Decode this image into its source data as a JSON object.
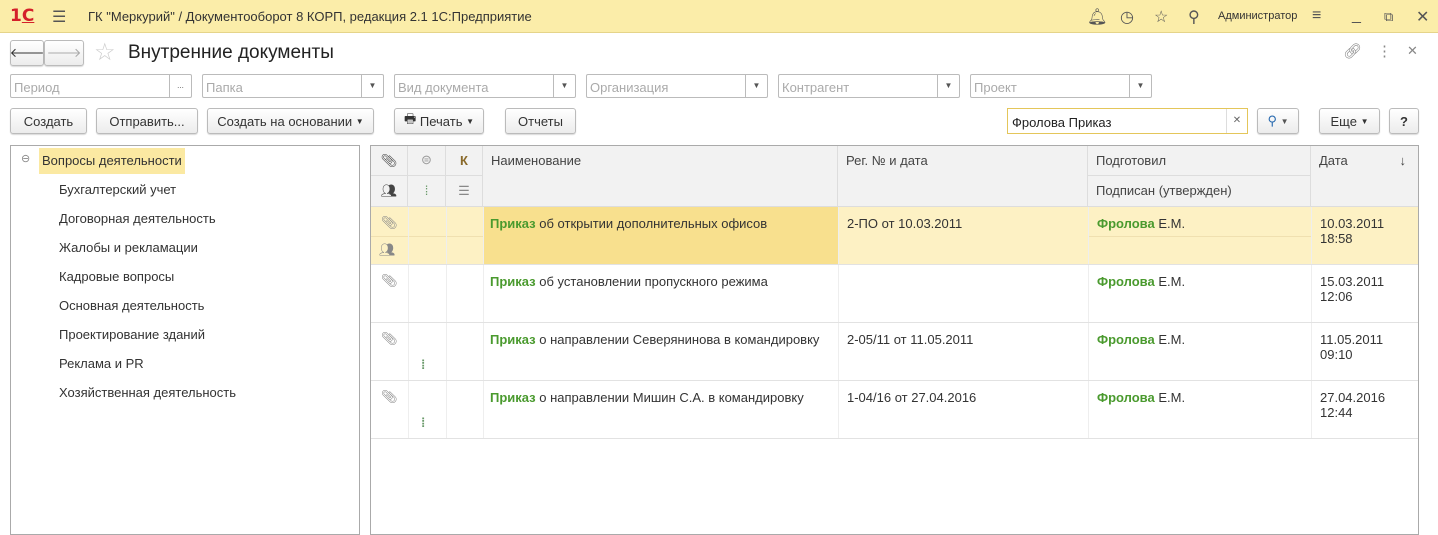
{
  "app": {
    "title": "ГК \"Меркурий\" / Документооборот 8 КОРП, редакция 2.1 1С:Предприятие",
    "logo": "1С",
    "user": "Администратор"
  },
  "form": {
    "title": "Внутренние документы"
  },
  "filters": {
    "period": "Период",
    "folder": "Папка",
    "doc_type": "Вид документа",
    "organization": "Организация",
    "counterparty": "Контрагент",
    "project": "Проект",
    "period_btn": "..."
  },
  "toolbar": {
    "create": "Создать",
    "send": "Отправить...",
    "create_based": "Создать на основании",
    "print": "Печать",
    "reports": "Отчеты",
    "search_value": "Фролова Приказ",
    "more": "Еще",
    "help": "?"
  },
  "tree": {
    "root": "Вопросы деятельности",
    "items": [
      "Бухгалтерский учет",
      "Договорная деятельность",
      "Жалобы и рекламации",
      "Кадровые вопросы",
      "Основная деятельность",
      "Проектирование зданий",
      "Реклама и PR",
      "Хозяйственная деятельность"
    ]
  },
  "grid": {
    "headers": {
      "k": "К",
      "name": "Наименование",
      "reg": "Рег. № и дата",
      "prepared": "Подготовил",
      "signed": "Подписан (утвержден)",
      "date": "Дата",
      "sort": "↓"
    },
    "rows": [
      {
        "kind": "Приказ",
        "name": "об открытии дополнительных офисов",
        "reg": "2-ПО от 10.03.2011",
        "prep_bold": "Фролова",
        "prep_rest": "Е.М.",
        "date": "10.03.2011",
        "time": "18:58",
        "attach": true,
        "people": true,
        "tree": false,
        "selected": true
      },
      {
        "kind": "Приказ",
        "name": "об установлении пропускного режима",
        "reg": "",
        "prep_bold": "Фролова",
        "prep_rest": "Е.М.",
        "date": "15.03.2011",
        "time": "12:06",
        "attach": true,
        "people": false,
        "tree": false,
        "selected": false
      },
      {
        "kind": "Приказ",
        "name": "о направлении Северянинова в командировку",
        "reg": "2-05/11 от 11.05.2011",
        "prep_bold": "Фролова",
        "prep_rest": "Е.М.",
        "date": "11.05.2011",
        "time": "09:10",
        "attach": true,
        "people": false,
        "tree": true,
        "selected": false
      },
      {
        "kind": "Приказ",
        "name": "о направлении Мишин С.А. в командировку",
        "reg": "1-04/16 от 27.04.2016",
        "prep_bold": "Фролова",
        "prep_rest": "Е.М.",
        "date": "27.04.2016",
        "time": "12:44",
        "attach": true,
        "people": false,
        "tree": true,
        "selected": false
      }
    ]
  },
  "colors": {
    "titlebar": "#fbeda9",
    "selected_row": "#fdf1c4",
    "selected_cell": "#f8e08e",
    "accent_green": "#4a9a2e"
  }
}
